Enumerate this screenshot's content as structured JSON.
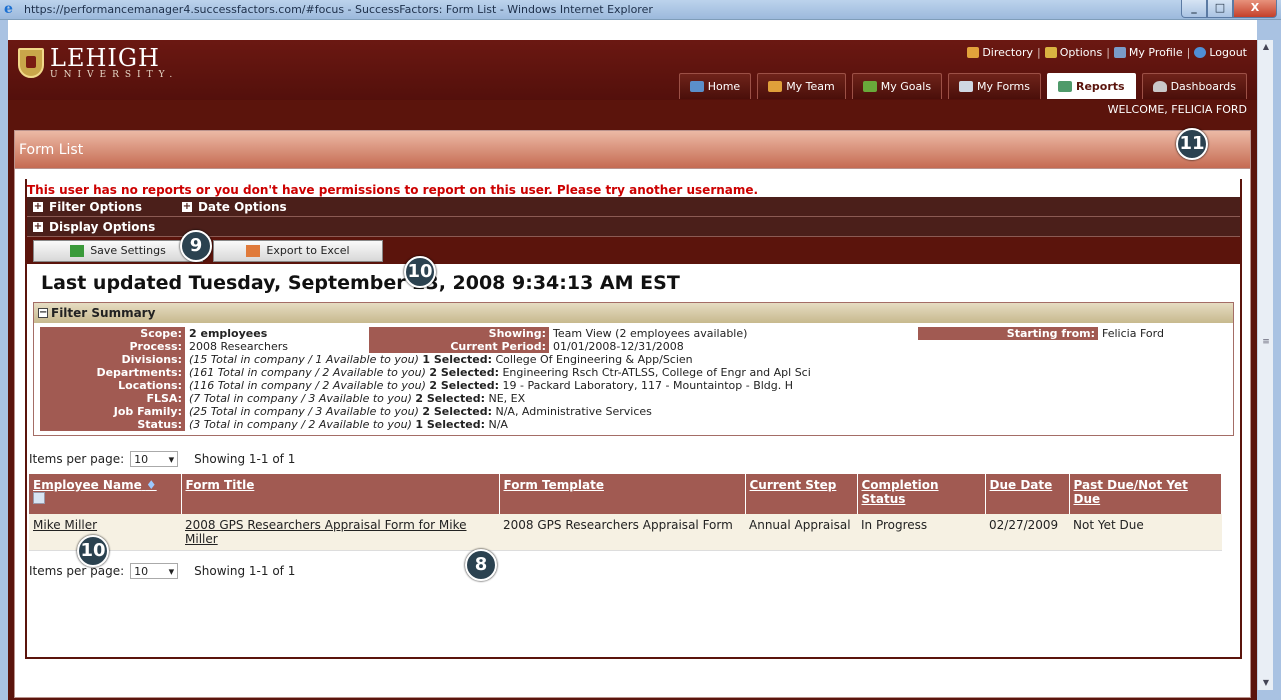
{
  "window": {
    "title": "https://performancemanager4.successfactors.com/#focus - SuccessFactors: Form List - Windows Internet Explorer"
  },
  "header": {
    "logo_name": "LEHIGH",
    "logo_sub": "UNIVERSITY.",
    "top_links": [
      {
        "label": "Directory",
        "icon": "directory-icon"
      },
      {
        "label": "Options",
        "icon": "options-icon"
      },
      {
        "label": "My Profile",
        "icon": "profile-icon"
      },
      {
        "label": "Logout",
        "icon": "logout-icon"
      }
    ],
    "tabs": [
      {
        "label": "Home",
        "icon": "home-icon"
      },
      {
        "label": "My Team",
        "icon": "team-icon"
      },
      {
        "label": "My Goals",
        "icon": "goals-icon"
      },
      {
        "label": "My Forms",
        "icon": "forms-icon"
      },
      {
        "label": "Reports",
        "icon": "reports-icon",
        "active": true
      },
      {
        "label": "Dashboards",
        "icon": "dashboards-icon"
      }
    ],
    "welcome": "WELCOME, FELICIA FORD"
  },
  "page": {
    "title": "Form List",
    "error": "This user has no reports or you don't have permissions to report on this user. Please try another username.",
    "filter_options": "Filter Options",
    "date_options": "Date Options",
    "display_options": "Display Options",
    "save_settings": "Save Settings",
    "export_excel": "Export to Excel",
    "last_updated": "Last updated Tuesday, September 23, 2008 9:34:13 AM EST"
  },
  "filter_summary": {
    "title": "Filter Summary",
    "scope_label": "Scope:",
    "scope_value": "2 employees",
    "showing_label": "Showing:",
    "showing_value": "Team View (2 employees available)",
    "starting_label": "Starting from:",
    "starting_value": "Felicia Ford",
    "process_label": "Process:",
    "process_value": "2008 Researchers",
    "period_label": "Current Period:",
    "period_value": "01/01/2008-12/31/2008",
    "rows": [
      {
        "label": "Divisions:",
        "italic": "(15 Total in company / 1 Available to you)",
        "bold": "1 Selected:",
        "value": "College Of Engineering & App/Scien"
      },
      {
        "label": "Departments:",
        "italic": "(161 Total in company / 2 Available to you)",
        "bold": "2 Selected:",
        "value": "Engineering Rsch Ctr-ATLSS, College of Engr and Apl Sci"
      },
      {
        "label": "Locations:",
        "italic": "(116 Total in company / 2 Available to you)",
        "bold": "2 Selected:",
        "value": "19 - Packard Laboratory, 117 - Mountaintop - Bldg. H"
      },
      {
        "label": "FLSA:",
        "italic": "(7 Total in company / 3 Available to you)",
        "bold": "2 Selected:",
        "value": "NE, EX"
      },
      {
        "label": "Job Family:",
        "italic": "(25 Total in company / 3 Available to you)",
        "bold": "2 Selected:",
        "value": "N/A, Administrative Services"
      },
      {
        "label": "Status:",
        "italic": "(3 Total in company / 2 Available to you)",
        "bold": "1 Selected:",
        "value": "N/A"
      }
    ]
  },
  "pagination": {
    "items_label": "Items per page:",
    "per_page": "10",
    "showing": "Showing 1-1 of 1"
  },
  "table": {
    "headers": [
      "Employee Name",
      "Form Title",
      "Form Template",
      "Current Step",
      "Completion Status",
      "Due Date",
      "Past Due/Not Yet Due"
    ],
    "rows": [
      [
        "Mike Miller",
        "2008 GPS Researchers Appraisal Form for Mike Miller",
        "2008 GPS Researchers Appraisal Form",
        "Annual Appraisal",
        "In Progress",
        "02/27/2009",
        "Not Yet Due"
      ]
    ]
  },
  "callouts": [
    "9",
    "10",
    "11",
    "10",
    "8"
  ]
}
